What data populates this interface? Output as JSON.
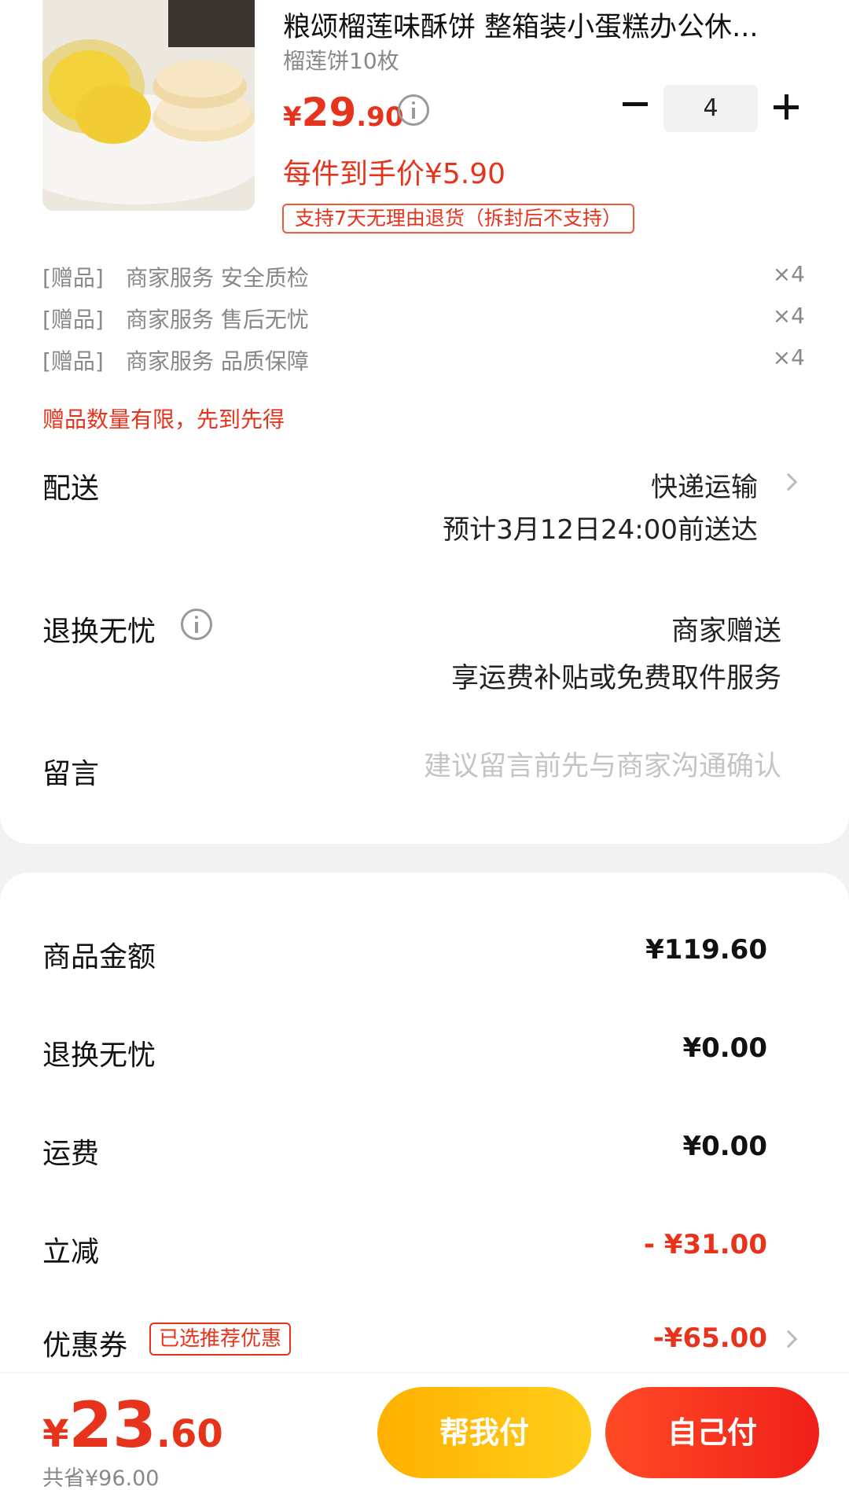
{
  "product": {
    "title": "粮颂榴莲味酥饼 整箱装小蛋糕办公休...",
    "spec": "榴莲饼10枚",
    "price_currency": "¥",
    "price_integer": "29",
    "price_decimal": ".90",
    "unit_price": "每件到手价¥5.90",
    "return_policy": "支持7天无理由退货（拆封后不支持）",
    "quantity": "4",
    "image_icon": "durian-pastry-photo"
  },
  "gifts": [
    {
      "tag": "[赠品]",
      "name": "商家服务 安全质检",
      "qty": "×4"
    },
    {
      "tag": "[赠品]",
      "name": "商家服务 售后无忧",
      "qty": "×4"
    },
    {
      "tag": "[赠品]",
      "name": "商家服务 品质保障",
      "qty": "×4"
    }
  ],
  "gift_note": "赠品数量有限，先到先得",
  "delivery": {
    "label": "配送",
    "method": "快递运输",
    "eta": "预计3月12日24:00前送达"
  },
  "return_service": {
    "label": "退换无忧",
    "provider": "商家赠送",
    "description": "享运费补贴或免费取件服务"
  },
  "message": {
    "label": "留言",
    "placeholder": "建议留言前先与商家沟通确认"
  },
  "summary": {
    "goods_label": "商品金额",
    "goods_value": "¥119.60",
    "return_label": "退换无忧",
    "return_value": "¥0.00",
    "shipping_label": "运费",
    "shipping_value": "¥0.00",
    "discount_label": "立减",
    "discount_value": "- ¥31.00",
    "coupon_label": "优惠券",
    "coupon_tag": "已选推荐优惠",
    "coupon_value": "-¥65.00"
  },
  "bottom": {
    "total_currency": "¥",
    "total_integer": "23",
    "total_decimal": ".60",
    "saved": "共省¥96.00",
    "help_pay_label": "帮我付",
    "self_pay_label": "自己付"
  },
  "colors": {
    "accent_red": "#e8331c",
    "help_button": "#ffb000",
    "self_button": "#f0201a"
  }
}
